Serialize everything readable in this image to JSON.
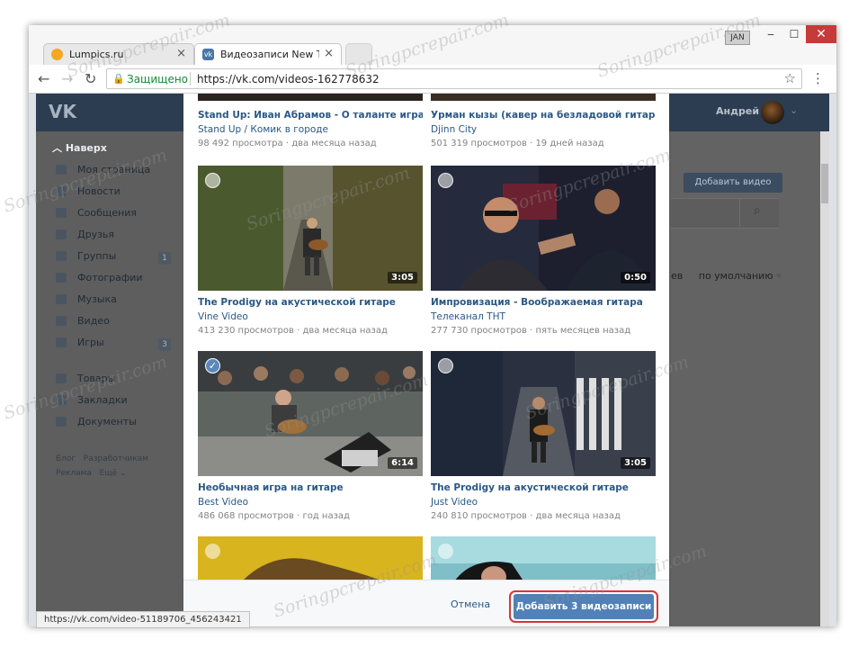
{
  "browser": {
    "tabs": [
      {
        "title": "Lumpics.ru",
        "active": false
      },
      {
        "title": "Видеозаписи New Two",
        "active": true
      }
    ],
    "profile": "JAN",
    "window_controls": {
      "minimize": "‒",
      "maximize": "☐",
      "close": "✕"
    },
    "security_label": "Защищено",
    "url": "https://vk.com/videos-162778632",
    "status_url": "https://vk.com/video-51189706_456243421"
  },
  "vk": {
    "logo": "VK",
    "user": "Андрей",
    "back_label": "Наверх",
    "sidebar": [
      {
        "label": "Моя страница"
      },
      {
        "label": "Новости"
      },
      {
        "label": "Сообщения"
      },
      {
        "label": "Друзья"
      },
      {
        "label": "Группы",
        "badge": "1"
      },
      {
        "label": "Фотографии"
      },
      {
        "label": "Музыка"
      },
      {
        "label": "Видео"
      },
      {
        "label": "Игры",
        "badge": "3"
      },
      {
        "label": "Товары"
      },
      {
        "label": "Закладки"
      },
      {
        "label": "Документы"
      }
    ],
    "footer_links": [
      "Блог",
      "Разработчикам",
      "Реклама",
      "Ещё"
    ],
    "add_video_label": "Добавить видео",
    "sort_prefix": "ев",
    "sort_label": "по умолчанию"
  },
  "modal": {
    "videos": [
      {
        "title": "Stand Up: Иван Абрамов - О таланте играть на г...",
        "author": "Stand Up / Комик в городе",
        "views": "98 492 просмотра",
        "date": "два месяца назад"
      },
      {
        "title": "Урман кызы (кавер на безладовой гитаре и Ко...",
        "author": "Djinn City",
        "views": "501 319 просмотров",
        "date": "19 дней назад"
      },
      {
        "title": "The Prodigy на акустической гитаре",
        "author": "Vine Video",
        "views": "413 230 просмотров",
        "date": "два месяца назад",
        "duration": "3:05",
        "selected": false
      },
      {
        "title": "Импровизация - Воображаемая гитара",
        "author": "Телеканал ТНТ",
        "views": "277 730 просмотров",
        "date": "пять месяцев назад",
        "duration": "0:50",
        "selected": false
      },
      {
        "title": "Необычная игра на гитаре",
        "author": "Best Video",
        "views": "486 068 просмотров",
        "date": "год назад",
        "duration": "6:14",
        "selected": true
      },
      {
        "title": "The Prodigy на акустической гитаре",
        "author": "Just Video",
        "views": "240 810 просмотров",
        "date": "два месяца назад",
        "duration": "3:05",
        "selected": false
      }
    ],
    "meta_separator": " · ",
    "cancel_label": "Отмена",
    "add_label": "Добавить 3 видеозаписи"
  },
  "watermark": "Soringpcrepair.com",
  "colors": {
    "vk_header": "#2c3d52",
    "link": "#2a5885",
    "primary_button": "#5181b8",
    "highlight_ring": "#d63737"
  }
}
